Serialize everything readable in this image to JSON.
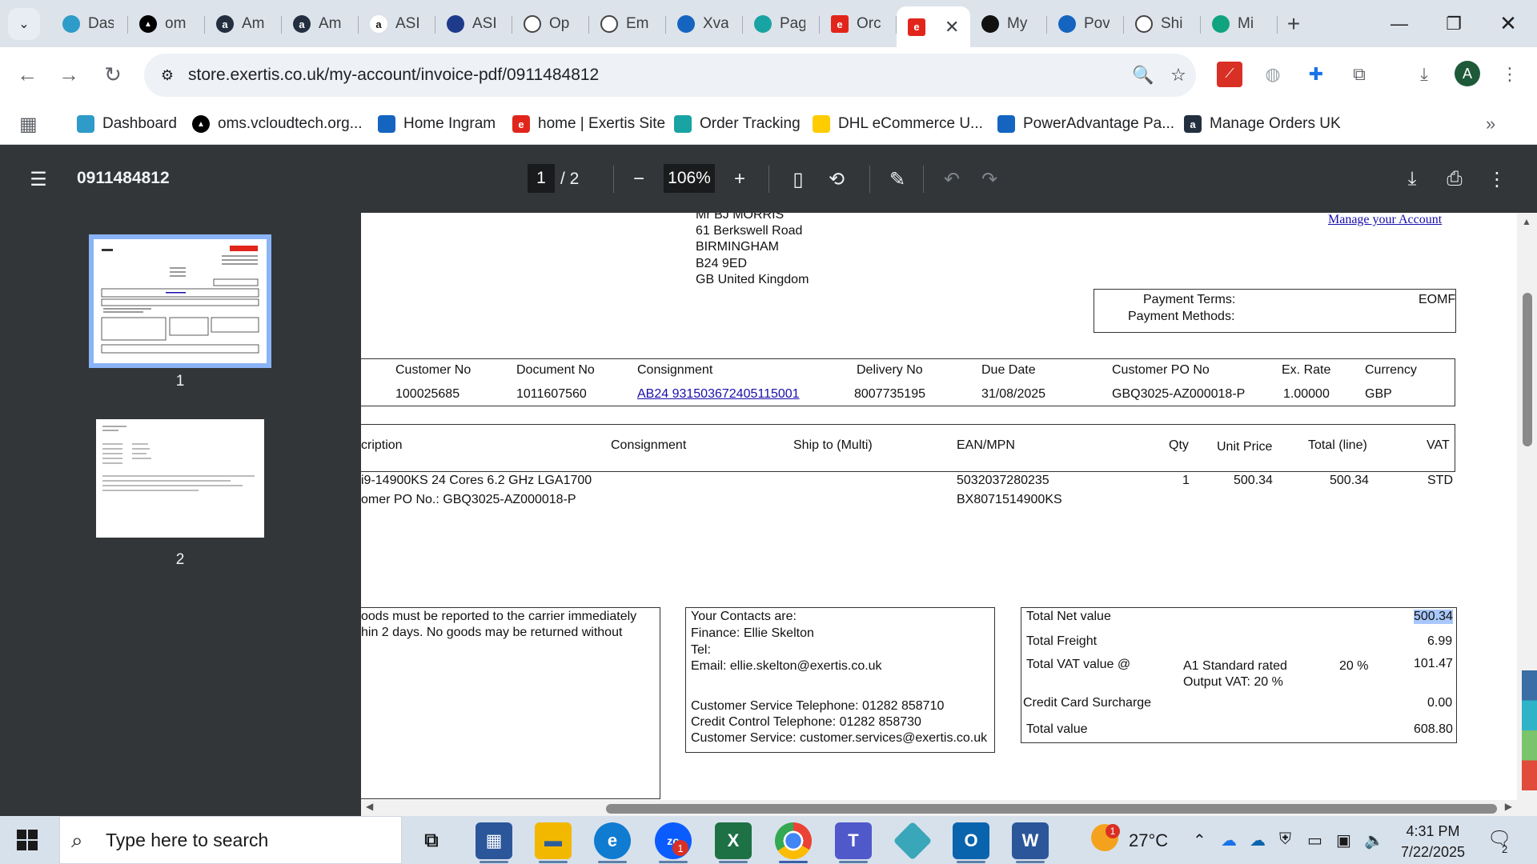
{
  "browser": {
    "tabs": [
      {
        "title": "Das",
        "icon": "dashboard-icon",
        "color": "#2e9bc9"
      },
      {
        "title": "om",
        "icon": "vercel-icon",
        "color": "#000000"
      },
      {
        "title": "Am",
        "icon": "amazon-icon",
        "color": "#232f3e"
      },
      {
        "title": "Am",
        "icon": "amazon-icon",
        "color": "#232f3e"
      },
      {
        "title": "ASI",
        "icon": "amazon-icon",
        "color": "#ffffff"
      },
      {
        "title": "ASI",
        "icon": "play-icon",
        "color": "#1e3a8a"
      },
      {
        "title": "Op",
        "icon": "openai-icon",
        "color": "#ffffff"
      },
      {
        "title": "Em",
        "icon": "openai-icon",
        "color": "#ffffff"
      },
      {
        "title": "Xva",
        "icon": "xvantage-icon",
        "color": "#1565c0"
      },
      {
        "title": "Pag",
        "icon": "order-tracking-icon",
        "color": "#1aa3a3"
      },
      {
        "title": "Orc",
        "icon": "exertis-icon",
        "color": "#e1251b"
      },
      {
        "title": "",
        "icon": "exertis-icon",
        "color": "#e1251b",
        "active": true
      },
      {
        "title": "My",
        "icon": "notion-icon",
        "color": "#111111"
      },
      {
        "title": "Pov",
        "icon": "forms-icon",
        "color": "#1565c0"
      },
      {
        "title": "Shi",
        "icon": "google-icon",
        "color": "#ffffff"
      },
      {
        "title": "Mi",
        "icon": "mi-icon",
        "color": "#10a37f"
      }
    ],
    "url": "store.exertis.co.uk/my-account/invoice-pdf/0911484812",
    "profile_initial": "A",
    "bookmarks": [
      {
        "label": "Dashboard",
        "icon": "dashboard-icon"
      },
      {
        "label": "oms.vcloudtech.org...",
        "icon": "vercel-icon"
      },
      {
        "label": "Home Ingram",
        "icon": "ingram-icon"
      },
      {
        "label": "home | Exertis Site",
        "icon": "exertis-icon"
      },
      {
        "label": "Order Tracking",
        "icon": "order-tracking-icon"
      },
      {
        "label": "DHL eCommerce U...",
        "icon": "dhl-icon"
      },
      {
        "label": "PowerAdvantage Pa...",
        "icon": "forms-icon"
      },
      {
        "label": "Manage Orders UK",
        "icon": "amazon-icon"
      }
    ]
  },
  "pdf": {
    "title": "0911484812",
    "page_current": "1",
    "page_total": "/ 2",
    "zoom": "106%",
    "thumbnails": [
      "1",
      "2"
    ]
  },
  "invoice": {
    "address": [
      "Mr BJ MORRIS",
      "61 Berkswell Road",
      "BIRMINGHAM",
      "B24 9ED",
      "GB United Kingdom"
    ],
    "manage_link": "Manage your Account",
    "payment_terms_label": "Payment Terms:",
    "payment_terms_value": "EOMF",
    "payment_methods_label": "Payment Methods:",
    "header_cols": [
      "Customer No",
      "Document No",
      "Consignment",
      "Delivery No",
      "Due Date",
      "Customer PO No",
      "Ex. Rate",
      "Currency"
    ],
    "header_vals": [
      "100025685",
      "1011607560",
      "AB24 931503672405115001",
      "8007735195",
      "31/08/2025",
      "GBQ3025-AZ000018-P",
      "1.00000",
      "GBP"
    ],
    "line_cols": [
      "cription",
      "Consignment",
      "Ship to (Multi)",
      "EAN/MPN",
      "Qty",
      "Unit Price",
      "Total (line)",
      "VAT"
    ],
    "line_desc1": "i9-14900KS 24 Cores 6.2 GHz LGA1700",
    "line_desc2": "omer PO No.: GBQ3025-AZ000018-P",
    "line_ean": "5032037280235",
    "line_mpn": "BX8071514900KS",
    "line_qty": "1",
    "line_unit": "500.34",
    "line_total": "500.34",
    "line_vat": "STD",
    "notice1": "oods must be reported to the carrier immediately",
    "notice2": "hin 2 days. No goods may be returned without",
    "contacts": {
      "heading": "Your Contacts are:",
      "finance": "Finance: Ellie Skelton",
      "tel": "Tel:",
      "email": "Email: ellie.skelton@exertis.co.uk",
      "cs_tel": "Customer Service Telephone:   01282 858710",
      "cc_tel": "Credit Control Telephone:   01282 858730",
      "cs_email": "Customer Service:   customer.services@exertis.co.uk"
    },
    "totals": {
      "net_label": "Total Net value",
      "net": "500.34",
      "freight_label": "Total Freight",
      "freight": "6.99",
      "vat_label": "Total VAT value @",
      "vat_rate_name": "A1 Standard rated",
      "vat_rate_sub": "Output VAT: 20 %",
      "vat_pct": "20 %",
      "vat": "101.47",
      "cc_label": "Credit Card Surcharge",
      "cc": "0.00",
      "total_label": "Total value",
      "total": "608.80"
    }
  },
  "taskbar": {
    "search_placeholder": "Type here to search",
    "weather": "27°C",
    "time": "4:31 PM",
    "date": "7/22/2025",
    "notif_count": "2",
    "zoom_badge": "1",
    "weather_badge": "1"
  }
}
